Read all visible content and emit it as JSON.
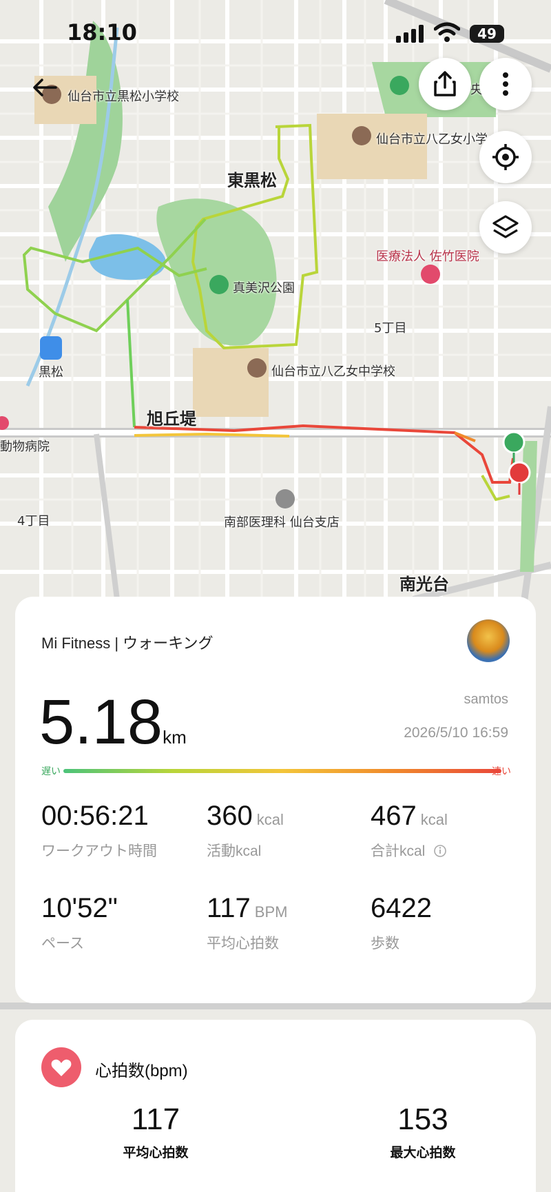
{
  "status_bar": {
    "time": "18:10",
    "battery": "49"
  },
  "map": {
    "labels": {
      "school1": "仙台市立黒松小学校",
      "school2": "仙台市立八乙女小学",
      "district1": "東黒松",
      "clinic": "医療法人 佐竹医院",
      "park": "真美沢公園",
      "block5": "5丁目",
      "station": "黒松",
      "school3": "仙台市立八乙女中学校",
      "district2": "旭丘堤",
      "animal_hospital": "動物病院",
      "block4": "4丁目",
      "nambu": "南部医理科 仙台支店",
      "district3": "南光台",
      "park_fragment": "央"
    },
    "route_color_slow": "#4cc37a",
    "route_color_fast": "#e9473a"
  },
  "summary": {
    "source": "Mi Fitness | ウォーキング",
    "distance": "5.18",
    "distance_unit": "km",
    "user": "samtos",
    "datetime": "2026/5/10 16:59",
    "slow_label": "遅い",
    "fast_label": "速い",
    "stats": [
      {
        "value": "00:56:21",
        "unit": "",
        "label": "ワークアウト時間"
      },
      {
        "value": "360",
        "unit": "kcal",
        "label": "活動kcal"
      },
      {
        "value": "467",
        "unit": "kcal",
        "label": "合計kcal"
      },
      {
        "value": "10'52\"",
        "unit": "",
        "label": "ペース"
      },
      {
        "value": "117",
        "unit": "BPM",
        "label": "平均心拍数"
      },
      {
        "value": "6422",
        "unit": "",
        "label": "歩数"
      }
    ]
  },
  "heart_rate": {
    "title": "心拍数(bpm)",
    "avg_value": "117",
    "avg_label": "平均心拍数",
    "max_value": "153",
    "max_label": "最大心拍数"
  }
}
